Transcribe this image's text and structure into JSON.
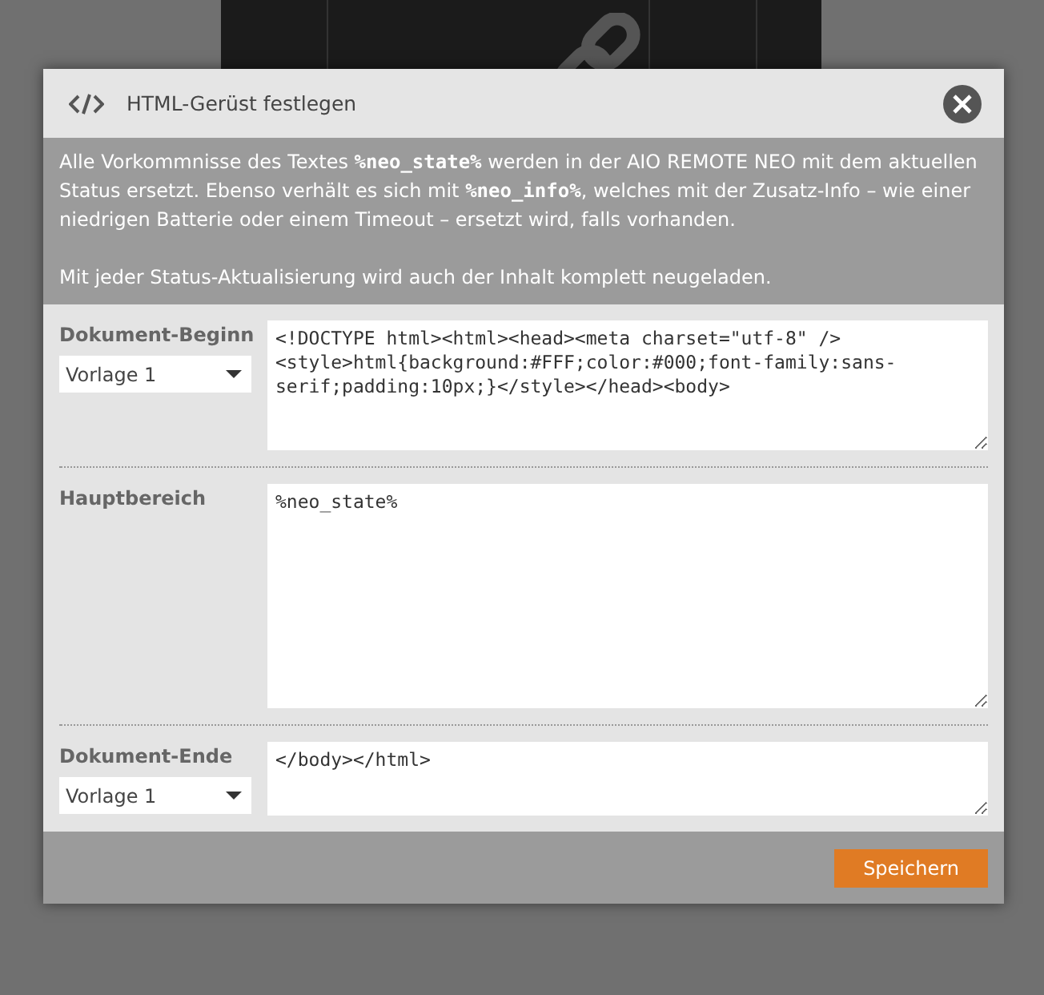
{
  "dialog": {
    "title": "HTML-Gerüst festlegen",
    "info": [
      "Alle Vorkommnisse des Textes **%neo_state%** werden in der AIO REMOTE NEO mit dem aktuellen Status ersetzt. Ebenso verhält es sich mit **%neo_info%**, welches mit der Zusatz-Info – wie einer niedrigen Batterie oder einem Timeout – ersetzt wird, falls vorhanden.",
      "Mit jeder Status-Aktualisierung wird auch der Inhalt komplett neugeladen."
    ],
    "sections": [
      {
        "label": "Dokument-Beginn",
        "template": "Vorlage 1",
        "code": "<!DOCTYPE html><html><head><meta charset=\"utf-8\" />\n<style>html{background:#FFF;color:#000;font-family:sans-serif;padding:10px;}</style></head><body>"
      },
      {
        "label": "Hauptbereich",
        "code": "%neo_state%"
      },
      {
        "label": "Dokument-Ende",
        "template": "Vorlage 1",
        "code": "</body></html>"
      }
    ],
    "buttons": [
      {
        "label": "Speichern"
      }
    ]
  }
}
